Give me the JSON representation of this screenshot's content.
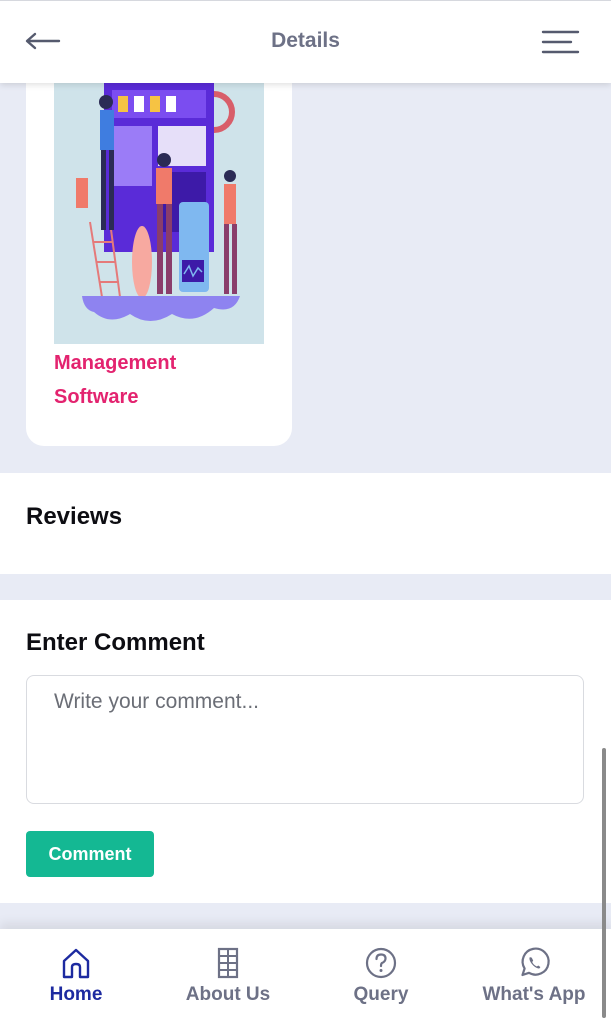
{
  "header": {
    "title": "Details"
  },
  "card": {
    "title_line1": "Management",
    "title_line2": "Software"
  },
  "reviews": {
    "heading": "Reviews"
  },
  "comment": {
    "heading": "Enter Comment",
    "placeholder": "Write your comment...",
    "value": "",
    "button_label": "Comment"
  },
  "nav": {
    "items": [
      {
        "label": "Home",
        "icon": "home-icon",
        "active": true
      },
      {
        "label": "About Us",
        "icon": "building-icon",
        "active": false
      },
      {
        "label": "Query",
        "icon": "question-icon",
        "active": false
      },
      {
        "label": "What's App",
        "icon": "whatsapp-icon",
        "active": false
      }
    ]
  },
  "colors": {
    "accent": "#14b893",
    "card_title": "#e3236f",
    "active_nav": "#1d2aa0",
    "inactive_nav": "#6d7186",
    "page_bg": "#e8ebf5"
  }
}
